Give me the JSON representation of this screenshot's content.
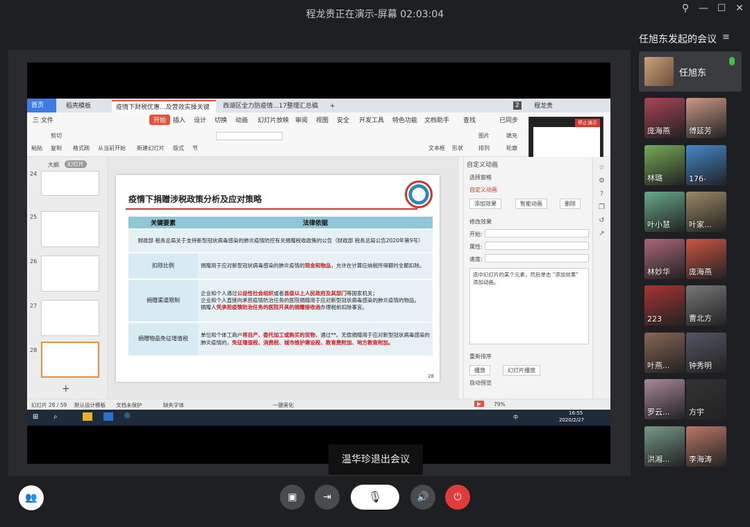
{
  "window": {
    "title": "程龙贵正在演示-屏幕 02:03:04"
  },
  "meeting": {
    "title": "任旭东发起的会议",
    "host": "任旭东",
    "participants": [
      "庞海燕",
      "傅延芳",
      "林璐",
      "176-",
      "叶小慧",
      "叶家...",
      "林妙华",
      "庞海燕",
      "223",
      "曹北方",
      "叶燕...",
      "钟秀明",
      "罗云...",
      "方宇",
      "洪湘...",
      "李海涛"
    ]
  },
  "toast": "温华珍退出会议",
  "wps": {
    "tabs": {
      "home": "首页",
      "t1": "稻壳模板",
      "t2": "疫情下财税优惠...及营效实操关键",
      "t3": "西湖区全力防疫情...17整理汇总稿",
      "badge": "2",
      "user": "程龙贵"
    },
    "menu": {
      "file": "三 文件",
      "start": "开始",
      "insert": "插入",
      "design": "设计",
      "switch": "切换",
      "anim": "动画",
      "show": "幻灯片放映",
      "review": "审阅",
      "view": "视图",
      "security": "安全",
      "dev": "开发工具",
      "special": "特色功能",
      "doc": "文档助手",
      "search": "查找",
      "sync": "已同步"
    },
    "ribbon": {
      "paste": "粘贴",
      "cut": "剪切",
      "copy": "复制",
      "format": "格式刷",
      "playfrom": "从当前开始",
      "newslide": "新建幻灯片",
      "layout": "版式",
      "section": "节",
      "textbox": "文本框",
      "shape": "形状",
      "picture": "图片",
      "arrange": "排列",
      "fill": "填充",
      "outline": "轮廓"
    },
    "preview_stop": "停止演示",
    "leftpane": {
      "outline": "大纲",
      "slides": "幻灯片",
      "nums": [
        "24",
        "25",
        "26",
        "27",
        "28"
      ]
    },
    "slide": {
      "title": "疫情下捐赠涉税政策分析及应对策略",
      "head_key": "关键要素",
      "head_val": "法律依据",
      "r1": "财政部 税务总局关于支持新型冠状病毒感染的肺炎疫情防控有关捐赠税收政策的公告（财政部 税务总局公告2020年第9号）",
      "r2k": "扣除比例",
      "r2a": "捐赠用于应对新型冠状病毒感染的肺炎疫情的",
      "r2r": "现金和物品",
      "r2b": "，允许在计算应纳税所得额时全额扣除。",
      "r3k": "捐赠渠道限制",
      "r3a": "企业和个人通过",
      "r3r1": "公益性社会组织",
      "r3b": "或者",
      "r3r2": "县级以上人民政府及其部门",
      "r3c": "等国家机关；",
      "r3d": "企业和个人直接向承担疫情防治任务的医院捐赠用于应对新型冠状病毒感染的肺炎疫情的物品。",
      "r3e": "捐赠人",
      "r3r3": "凭承担疫情防治任务的医院开具的捐赠接收函",
      "r3f": "办理税前扣除事宜。",
      "r4k": "捐赠物品免征增值税",
      "r4a": "单位和个体工商户",
      "r4r1": "将自产、委托加工或购买的货物",
      "r4b": "，通过**。无偿捐赠用于应对新型冠状病毒感染的肺炎疫情的，",
      "r4r2": "免征增值税、消费税、城市维护建设税、教育费附加、地方教育附加。",
      "page": "28"
    },
    "rpane": {
      "custom_anim": "自定义动画",
      "select_pane": "选择窗格",
      "custom_anim2": "自定义动画",
      "add_effect": "添加效果",
      "smart_anim": "智能动画",
      "delete": "删除",
      "modify": "修改效果",
      "start": "开始:",
      "prop": "属性:",
      "speed": "速度:",
      "hint": "选中幻灯片的某个元素，然后单击 \"添加效果\" 添加动画。",
      "reorder": "重新排序",
      "play": "播放",
      "slideshow": "幻灯片播放",
      "autopreview": "自动预览"
    },
    "status": {
      "slide": "幻灯片 28 / 59",
      "theme": "默认设计模板",
      "protect": "文档未保护",
      "font": "缺失字体",
      "beautify": "一键美化",
      "zoom": "79%"
    },
    "taskbar": {
      "time": "16:55",
      "date": "2020/2/27",
      "ime": "中"
    }
  },
  "colors": {
    "accent_red": "#e4543c",
    "table_head": "#8fc6d8",
    "hangup": "#e23b3b",
    "mic_active": "#3ec24a"
  }
}
